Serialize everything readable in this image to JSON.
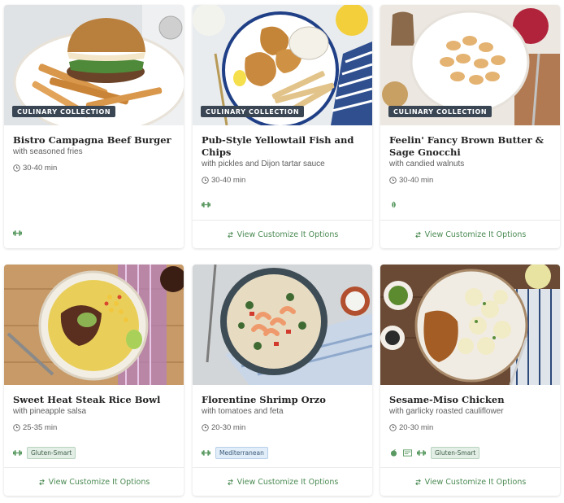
{
  "recipes": [
    {
      "title": "Bistro Campagna Beef Burger",
      "subtitle": "with seasoned fries",
      "time": "30-40 min",
      "badge": "CULINARY COLLECTION",
      "tags": [],
      "icons": [
        "dumbbell-icon"
      ],
      "cta": ""
    },
    {
      "title": "Pub-Style Yellowtail Fish and Chips",
      "subtitle": "with pickles and Dijon tartar sauce",
      "time": "30-40 min",
      "badge": "CULINARY COLLECTION",
      "tags": [],
      "icons": [
        "dumbbell-icon"
      ],
      "cta": "View Customize It Options"
    },
    {
      "title": "Feelin' Fancy Brown Butter & Sage Gnocchi",
      "subtitle": "with candied walnuts",
      "time": "30-40 min",
      "badge": "CULINARY COLLECTION",
      "tags": [],
      "icons": [
        "leaf-icon"
      ],
      "cta": "View Customize It Options"
    },
    {
      "title": "Sweet Heat Steak Rice Bowl",
      "subtitle": "with pineapple salsa",
      "time": "25-35 min",
      "badge": "",
      "tags": [
        "Gluten-Smart"
      ],
      "icons": [
        "dumbbell-icon"
      ],
      "cta": "View Customize It Options"
    },
    {
      "title": "Florentine Shrimp Orzo",
      "subtitle": "with tomatoes and feta",
      "time": "20-30 min",
      "badge": "",
      "tags": [
        "Mediterranean"
      ],
      "icons": [
        "dumbbell-icon"
      ],
      "cta": "View Customize It Options"
    },
    {
      "title": "Sesame-Miso Chicken",
      "subtitle": "with garlicky roasted cauliflower",
      "time": "20-30 min",
      "badge": "",
      "tags": [
        "Gluten-Smart"
      ],
      "icons": [
        "apple-icon",
        "calorie-icon",
        "dumbbell-icon"
      ],
      "cta": "View Customize It Options"
    }
  ],
  "colors": {
    "accent": "#4a8a52",
    "badge_bg": "#3a4654",
    "icon_green": "#5a9a62"
  }
}
